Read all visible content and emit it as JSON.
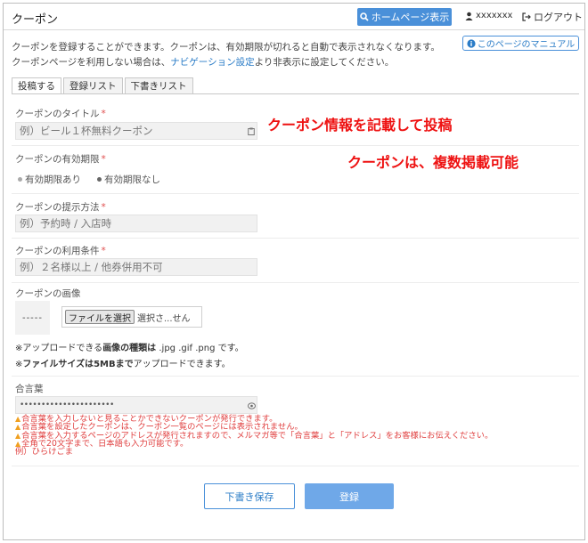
{
  "header": {
    "title": "クーポン",
    "home_button": "ホームページ表示",
    "user_name": "xxxxxxx",
    "logout": "ログアウト"
  },
  "description": {
    "line1": "クーポンを登録することができます。クーポンは、有効期限が切れると自動で表示されなくなります。",
    "line2_before": "クーポンページを利用しない場合は、",
    "line2_link": "ナビゲーション設定",
    "line2_after": "より非表示に設定してください。"
  },
  "manual_button": "このページのマニュアル",
  "tabs": [
    "投稿する",
    "登録リスト",
    "下書きリスト"
  ],
  "form": {
    "title_label": "クーポンのタイトル",
    "title_placeholder": "例）ビール１杯無料クーポン",
    "expiry_label": "クーポンの有効期限",
    "expiry_options": [
      "有効期限あり",
      "有効期限なし"
    ],
    "present_label": "クーポンの提示方法",
    "present_placeholder": "例）予約時 / 入店時",
    "conditions_label": "クーポンの利用条件",
    "conditions_placeholder": "例）２名様以上 / 他券併用不可",
    "image_label": "クーポンの画像",
    "image_thumb_text": "-----",
    "file_button": "ファイルを選択",
    "file_status": "選択さ...せん",
    "note1_prefix": "※アップロードできる",
    "note1_bold": "画像の種類は",
    "note1_suffix": " .jpg .gif .png です。",
    "note2_prefix": "※",
    "note2_bold": "ファイルサイズは5MBまで",
    "note2_suffix": "アップロードできます。",
    "password_label": "合言葉",
    "password_value": "••••••••••••••••••••••",
    "warnings": [
      "合言葉を入力しないと見ることかできないクーポンが発行できます。",
      "合言葉を設定したクーポンは、クーポン一覧のページには表示されません。",
      "合言葉を入力するページのアドレスが発行されますので、メルマガ等で「合言葉」と「アドレス」をお客様にお伝えください。",
      "全角で20文字まで、日本語も入力可能です。"
    ],
    "example": "例）ひらけごま"
  },
  "annotations": {
    "a1": "クーポン情報を記載して投稿",
    "a2": "クーポンは、複数掲載可能"
  },
  "buttons": {
    "draft": "下書き保存",
    "submit": "登録"
  },
  "required_mark": "*",
  "colors": {
    "accent": "#4a90d9",
    "required": "#e05050",
    "annotation": "#ee1111"
  }
}
